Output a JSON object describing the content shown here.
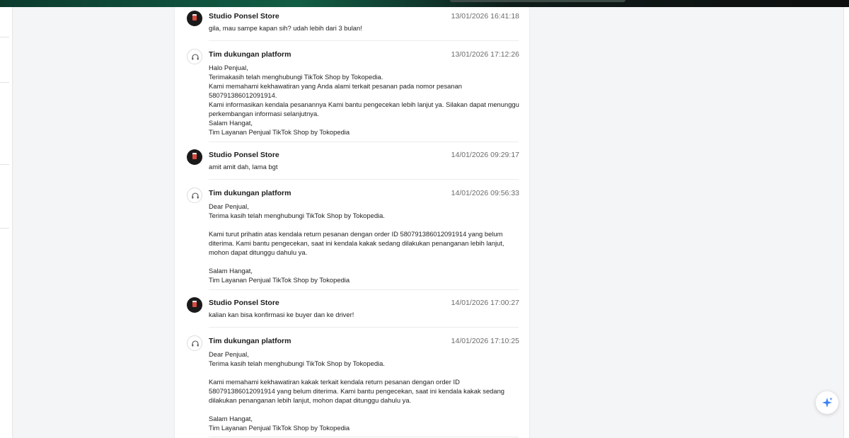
{
  "conversation": {
    "messages": [
      {
        "sender": "Studio Ponsel Store",
        "role": "store",
        "timestamp": "13/01/2026 16:41:18",
        "text": "gila, mau sampe kapan sih? udah lebih dari 3 bulan!"
      },
      {
        "sender": "Tim dukungan platform",
        "role": "support",
        "timestamp": "13/01/2026 17:12:26",
        "text": "Halo Penjual,\nTerimakasih telah menghubungi TikTok Shop by Tokopedia.\nKami memahami kekhawatiran yang Anda alami terkait pesanan pada nomor pesanan\n580791386012091914.\nKami informasikan kendala pesanannya Kami bantu pengecekan lebih lanjut ya. Silakan dapat menunggu\nperkembangan informasi selanjutnya.\nSalam Hangat,\nTim Layanan Penjual TikTok Shop by Tokopedia"
      },
      {
        "sender": "Studio Ponsel Store",
        "role": "store",
        "timestamp": "14/01/2026 09:29:17",
        "text": "amit amit dah, lama bgt"
      },
      {
        "sender": "Tim dukungan platform",
        "role": "support",
        "timestamp": "14/01/2026 09:56:33",
        "text": "Dear Penjual,\nTerima kasih telah menghubungi TikTok Shop by Tokopedia.\n\nKami turut prihatin atas kendala return pesanan dengan order ID 580791386012091914 yang belum\nditerima. Kami bantu pengecekan, saat ini kendala kakak sedang dilakukan penanganan lebih lanjut,\nmohon dapat ditunggu dahulu ya.\n\nSalam Hangat,\nTim Layanan Penjual TikTok Shop by Tokopedia"
      },
      {
        "sender": "Studio Ponsel Store",
        "role": "store",
        "timestamp": "14/01/2026 17:00:27",
        "text": "kalian kan bisa konfirmasi ke buyer dan ke driver!"
      },
      {
        "sender": "Tim dukungan platform",
        "role": "support",
        "timestamp": "14/01/2026 17:10:25",
        "text": "Dear Penjual,\nTerima kasih telah menghubungi TikTok Shop by Tokopedia.\n\nKami memahami kekhawatiran kakak terkait kendala return pesanan dengan order ID\n580791386012091914 yang belum diterima. Kami bantu pengecekan, saat ini kendala kakak sedang\ndilakukan penanganan lebih lanjut, mohon dapat ditunggu dahulu ya.\n\nSalam Hangat,\nTim Layanan Penjual TikTok Shop by Tokopedia"
      }
    ]
  },
  "icons": {
    "store_avatar": "store-logo-avatar",
    "support_avatar": "headset-icon",
    "fab": "sparkle-icon"
  },
  "colors": {
    "header_gradient_start": "#0c3b2e",
    "header_gradient_mid": "#125e45",
    "fab_icon": "#3b82f6"
  }
}
